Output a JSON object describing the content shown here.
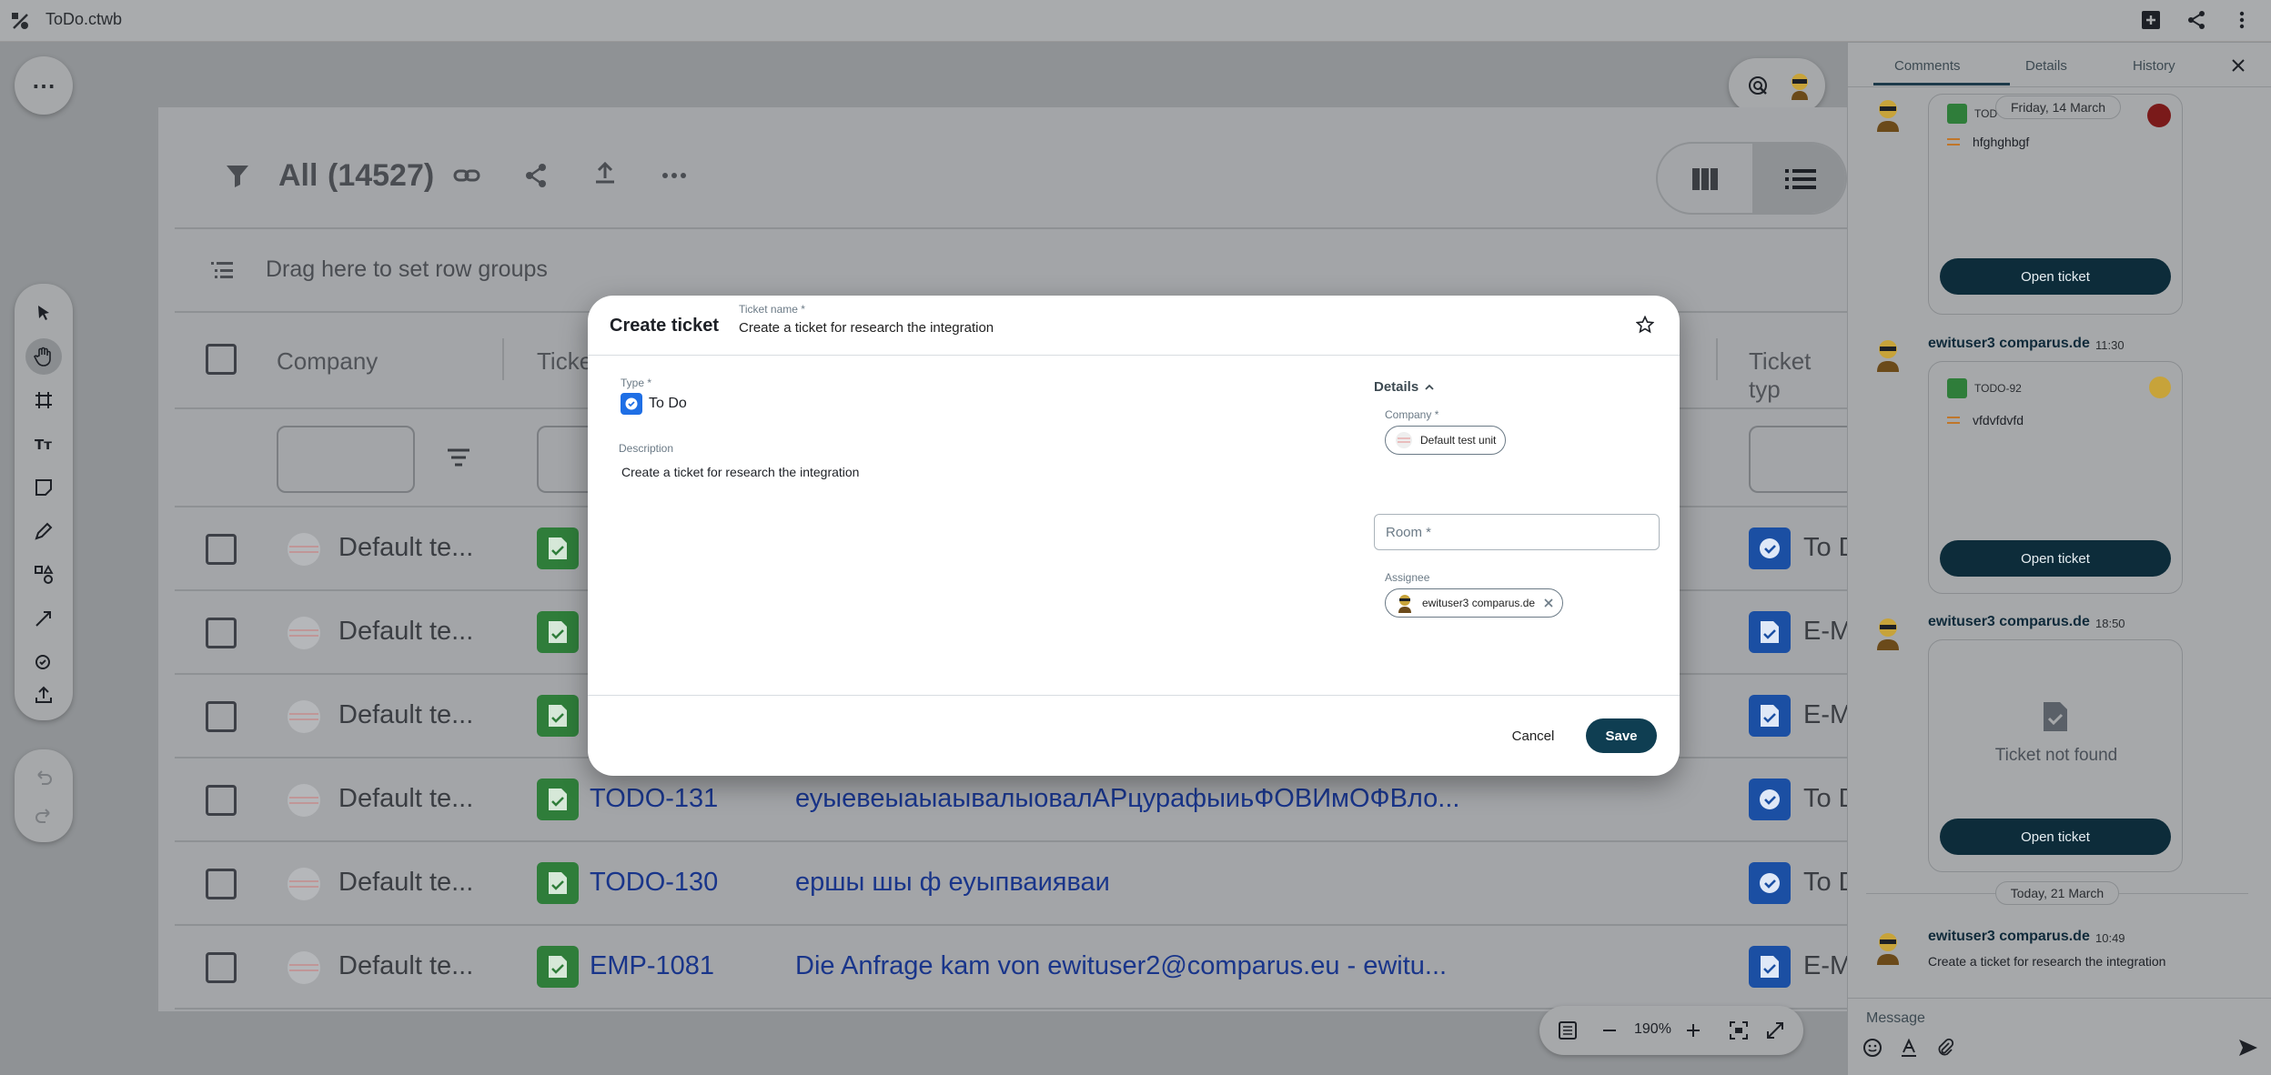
{
  "window": {
    "title": "ToDo.ctwb"
  },
  "canvas": {
    "more_label": "⋯",
    "zoom": "190%"
  },
  "grid": {
    "filter_title": "All",
    "count": "(14527)",
    "row_group_hint": "Drag here to set row groups",
    "columns": [
      "Company",
      "Ticke",
      "Ticket typ"
    ],
    "rows": [
      {
        "company": "Default te...",
        "id": "",
        "title": "",
        "type": "To D",
        "type_icon": "check-icon"
      },
      {
        "company": "Default te...",
        "id": "",
        "title": "",
        "type": "E-M",
        "type_icon": "doc-icon"
      },
      {
        "company": "Default te...",
        "id": "",
        "title": "",
        "type": "E-M",
        "type_icon": "doc-icon"
      },
      {
        "company": "Default te...",
        "id": "TODO-131",
        "title": "еуыевеыаыаывалыовалАРцурафыиьФОВИмОФВло...",
        "type": "To D",
        "type_icon": "check-icon"
      },
      {
        "company": "Default te...",
        "id": "TODO-130",
        "title": "ершы шы ф еуыпваияваи",
        "type": "To D",
        "type_icon": "check-icon"
      },
      {
        "company": "Default te...",
        "id": "EMP-1081",
        "title": "Die Anfrage kam von ewituser2@comparus.eu - ewitu...",
        "type": "E-M",
        "type_icon": "doc-icon"
      }
    ]
  },
  "modal": {
    "title": "Create ticket",
    "ticket_name_label": "Ticket name *",
    "ticket_name_value": "Create a ticket for research the integration",
    "type_label": "Type *",
    "type_value": "To Do",
    "description_label": "Description",
    "description_value": "Create a ticket for research the integration",
    "details_label": "Details",
    "company_label": "Company *",
    "company_value": "Default test unit",
    "room_placeholder": "Room *",
    "assignee_label": "Assignee",
    "assignee_value": "ewituser3 comparus.de",
    "cancel_label": "Cancel",
    "save_label": "Save"
  },
  "panel": {
    "tabs": [
      "Comments",
      "Details",
      "History"
    ],
    "active_tab": "Comments",
    "comments": [
      {
        "date_pill": "Friday, 14 March",
        "ticket_id": "TOD",
        "ticket_text": "hfghghbgf",
        "button": "Open ticket"
      },
      {
        "author": "ewituser3 comparus.de",
        "time": "11:30",
        "ticket_id": "TODO-92",
        "ticket_text": "vfdvfdvfd",
        "button": "Open ticket"
      },
      {
        "author": "ewituser3 comparus.de",
        "time": "18:50",
        "not_found": "Ticket not found",
        "button": "Open ticket"
      },
      {
        "date_pill": "Today, 21 March",
        "author": "ewituser3 comparus.de",
        "time": "10:49",
        "text": "Create a ticket for research the integration"
      }
    ],
    "message_placeholder": "Message"
  }
}
